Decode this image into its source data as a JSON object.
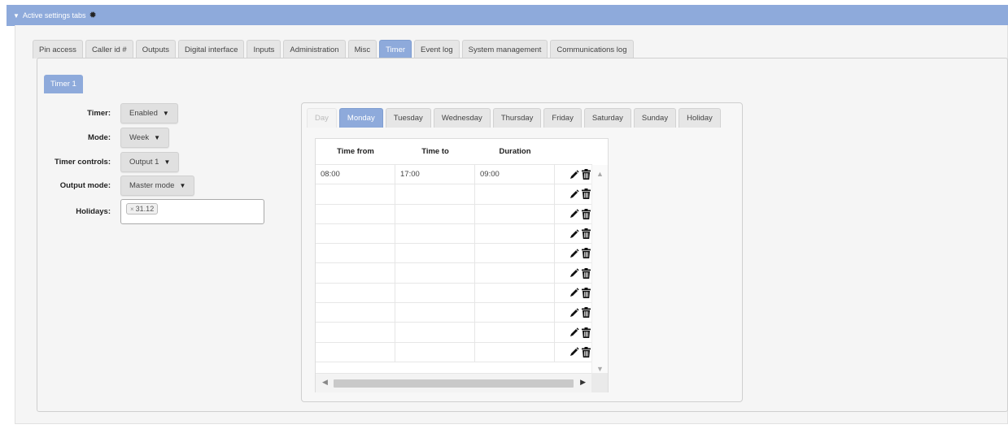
{
  "header": {
    "title": "Active settings tabs",
    "caret_icon": "triangle-down-icon",
    "gear_icon": "gear-icon"
  },
  "main_tabs": [
    {
      "label": "Pin access"
    },
    {
      "label": "Caller id #"
    },
    {
      "label": "Outputs"
    },
    {
      "label": "Digital interface"
    },
    {
      "label": "Inputs"
    },
    {
      "label": "Administration"
    },
    {
      "label": "Misc"
    },
    {
      "label": "Timer",
      "active": true
    },
    {
      "label": "Event log"
    },
    {
      "label": "System management"
    },
    {
      "label": "Communications log"
    }
  ],
  "sub_tab": {
    "label": "Timer 1"
  },
  "form": {
    "timer": {
      "label": "Timer:",
      "value": "Enabled"
    },
    "mode": {
      "label": "Mode:",
      "value": "Week"
    },
    "timer_controls": {
      "label": "Timer controls:",
      "value": "Output 1"
    },
    "output_mode": {
      "label": "Output mode:",
      "value": "Master mode"
    },
    "holidays": {
      "label": "Holidays:",
      "chips": [
        "31.12"
      ],
      "chip_remove_symbol": "×"
    }
  },
  "day_tabs": [
    {
      "label": "Day",
      "disabled": true
    },
    {
      "label": "Monday",
      "active": true
    },
    {
      "label": "Tuesday"
    },
    {
      "label": "Wednesday"
    },
    {
      "label": "Thursday"
    },
    {
      "label": "Friday"
    },
    {
      "label": "Saturday"
    },
    {
      "label": "Sunday"
    },
    {
      "label": "Holiday"
    }
  ],
  "grid": {
    "columns": [
      "Time from",
      "Time to",
      "Duration"
    ],
    "rows": [
      [
        "08:00",
        "17:00",
        "09:00"
      ],
      [
        "",
        "",
        ""
      ],
      [
        "",
        "",
        ""
      ],
      [
        "",
        "",
        ""
      ],
      [
        "",
        "",
        ""
      ],
      [
        "",
        "",
        ""
      ],
      [
        "",
        "",
        ""
      ],
      [
        "",
        "",
        ""
      ],
      [
        "",
        "",
        ""
      ],
      [
        "",
        "",
        ""
      ]
    ],
    "row_icons": [
      "pencil-icon",
      "trash-icon"
    ]
  },
  "colors": {
    "accent": "#8eaadb",
    "panel_bg": "#f5f5f5"
  }
}
